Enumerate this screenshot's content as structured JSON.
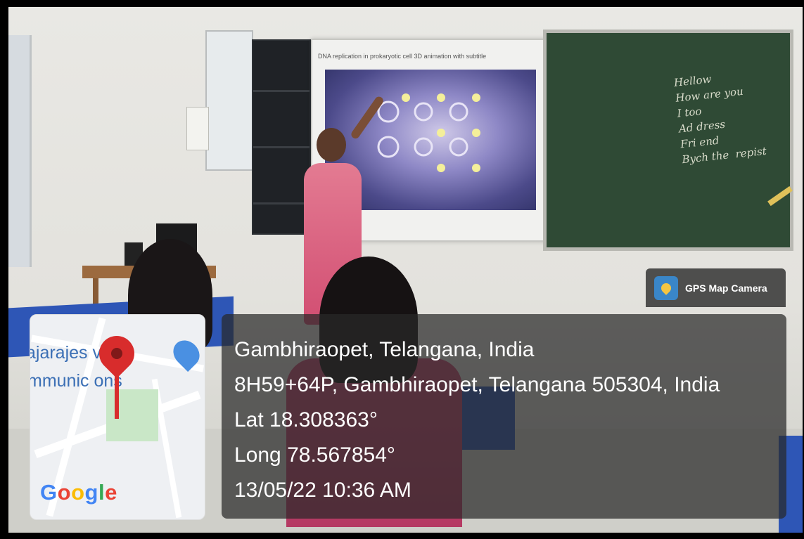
{
  "screen": {
    "video_title": "DNA replication in prokaryotic cell 3D animation with subtitle"
  },
  "board": {
    "handwriting": "Hellow\nHow are you\nI too\nAd dress\nFri end\nBych the  repist"
  },
  "gps_badge": {
    "label": "GPS Map Camera",
    "icon": "gps-map-camera-icon"
  },
  "location": {
    "place": "Gambhiraopet, Telangana, India",
    "address": "8H59+64P, Gambhiraopet, Telangana 505304, India",
    "lat": "Lat 18.308363°",
    "long": "Long 78.567854°",
    "datetime": "13/05/22 10:36 AM"
  },
  "map": {
    "label_line1": "ajarajes   vara",
    "label_line2": "mmunic    ons",
    "logo_text": "Google",
    "pin_icon": "map-pin-icon",
    "bag_icon": "shopping-bag-icon",
    "colors": {
      "pin": "#d82c2c",
      "label": "#3b6fb5",
      "park": "#c9e7c7"
    }
  }
}
